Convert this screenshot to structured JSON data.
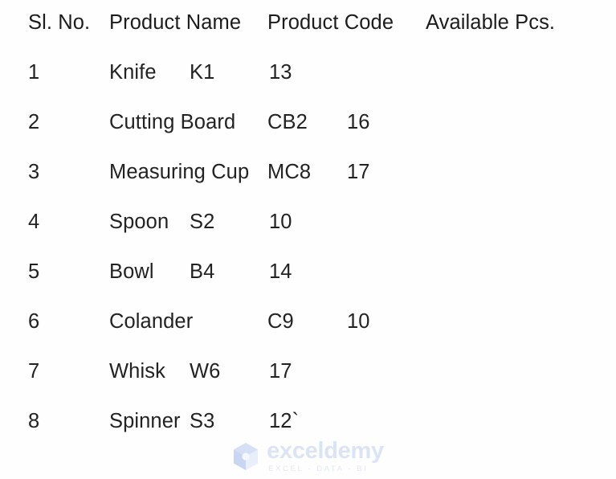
{
  "table": {
    "headers": {
      "sl_no": "Sl. No.",
      "product_name": "Product Name",
      "product_code": "Product Code",
      "available_pcs": "Available Pcs."
    },
    "rows": [
      {
        "sl_no": "1",
        "product_name": "Knife",
        "product_code": "K1",
        "available_pcs": "13",
        "tab_stop": "near"
      },
      {
        "sl_no": "2",
        "product_name": "Cutting Board",
        "product_code": "CB2",
        "available_pcs": "16",
        "tab_stop": "far"
      },
      {
        "sl_no": "3",
        "product_name": "Measuring Cup",
        "product_code": "MC8",
        "available_pcs": "17",
        "tab_stop": "far"
      },
      {
        "sl_no": "4",
        "product_name": "Spoon",
        "product_code": "S2",
        "available_pcs": "10",
        "tab_stop": "near"
      },
      {
        "sl_no": "5",
        "product_name": "Bowl",
        "product_code": "B4",
        "available_pcs": "14",
        "tab_stop": "near"
      },
      {
        "sl_no": "6",
        "product_name": "Colander",
        "product_code": "C9",
        "available_pcs": "10",
        "tab_stop": "far"
      },
      {
        "sl_no": "7",
        "product_name": "Whisk",
        "product_code": "W6",
        "available_pcs": "17",
        "tab_stop": "near"
      },
      {
        "sl_no": "8",
        "product_name": "Spinner",
        "product_code": "S3",
        "available_pcs": "12`",
        "tab_stop": "near"
      }
    ]
  },
  "watermark": {
    "icon": "exceldemy-cube-logo-icon",
    "name": "exceldemy",
    "tagline": "EXCEL - DATA - BI",
    "text_color": "#dbe4f7",
    "logo_color": "#d5dff5"
  },
  "colors": {
    "background": "#fefefe",
    "text": "#222222"
  }
}
